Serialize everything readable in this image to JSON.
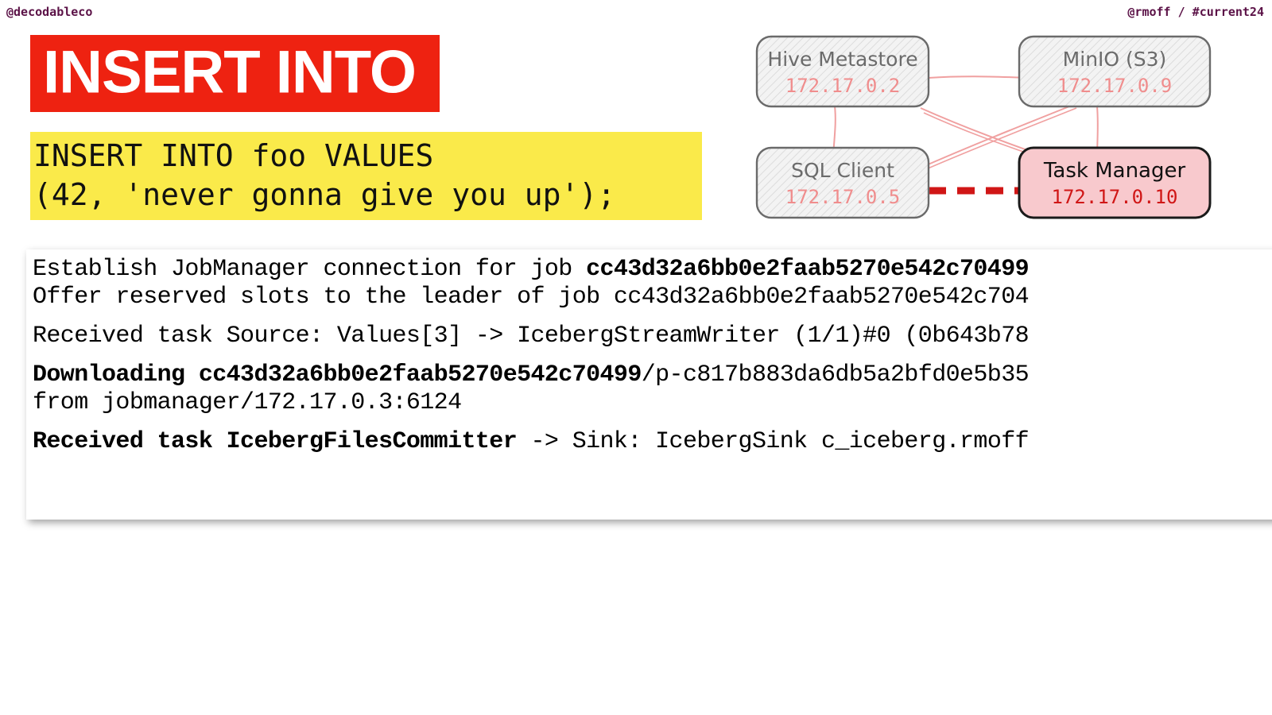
{
  "header": {
    "left": "@decodableco",
    "right": "@rmoff / #current24"
  },
  "title": {
    "text": "INSERT INTO",
    "background_color": "#ee2211",
    "text_color": "#ffffff"
  },
  "sql": {
    "background_color": "#faea4a",
    "lines": [
      "INSERT INTO foo VALUES",
      "(42, 'never gonna give you up');"
    ]
  },
  "diagram": {
    "nodes": [
      {
        "id": "hive",
        "label": "Hive Metastore",
        "ip": "172.17.0.2",
        "highlighted": false
      },
      {
        "id": "minio",
        "label": "MinIO (S3)",
        "ip": "172.17.0.9",
        "highlighted": false
      },
      {
        "id": "sqlclient",
        "label": "SQL Client",
        "ip": "172.17.0.5",
        "highlighted": false
      },
      {
        "id": "taskmanager",
        "label": "Task Manager",
        "ip": "172.17.0.10",
        "highlighted": true
      }
    ],
    "colors": {
      "node_fill": "#f2f2f2",
      "node_stroke": "#6a6a6a",
      "node_label": "#6b6b6b",
      "node_ip": "#f08d8d",
      "highlight_fill": "#f8c9cd",
      "highlight_stroke": "#1a1a1a",
      "highlight_label": "#111111",
      "highlight_ip": "#d01616",
      "link": "#f0a0a0",
      "active_link": "#d01616"
    }
  },
  "log": {
    "lines": [
      {
        "segments": [
          {
            "text": "Establish JobManager connection for job ",
            "bold": false
          },
          {
            "text": "cc43d32a6bb0e2faab5270e542c70499",
            "bold": true
          }
        ]
      },
      {
        "segments": [
          {
            "text": "Offer reserved slots to the leader of job cc43d32a6bb0e2faab5270e542c704",
            "bold": false
          }
        ]
      },
      {
        "spacer": true
      },
      {
        "segments": [
          {
            "text": "Received task Source: Values[3] -> IcebergStreamWriter (1/1)#0 (0b643b78",
            "bold": false
          }
        ]
      },
      {
        "spacer": true
      },
      {
        "segments": [
          {
            "text": "Downloading cc43d32a6bb0e2faab5270e542c70499",
            "bold": true
          },
          {
            "text": "/p-c817b883da6db5a2bfd0e5b35",
            "bold": false
          }
        ]
      },
      {
        "segments": [
          {
            "text": "from jobmanager/172.17.0.3:6124",
            "bold": false
          }
        ]
      },
      {
        "spacer": true
      },
      {
        "segments": [
          {
            "text": "Received task IcebergFilesCommitter ",
            "bold": true
          },
          {
            "text": "-> Sink: IcebergSink c_iceberg.rmoff",
            "bold": false
          }
        ]
      }
    ]
  }
}
